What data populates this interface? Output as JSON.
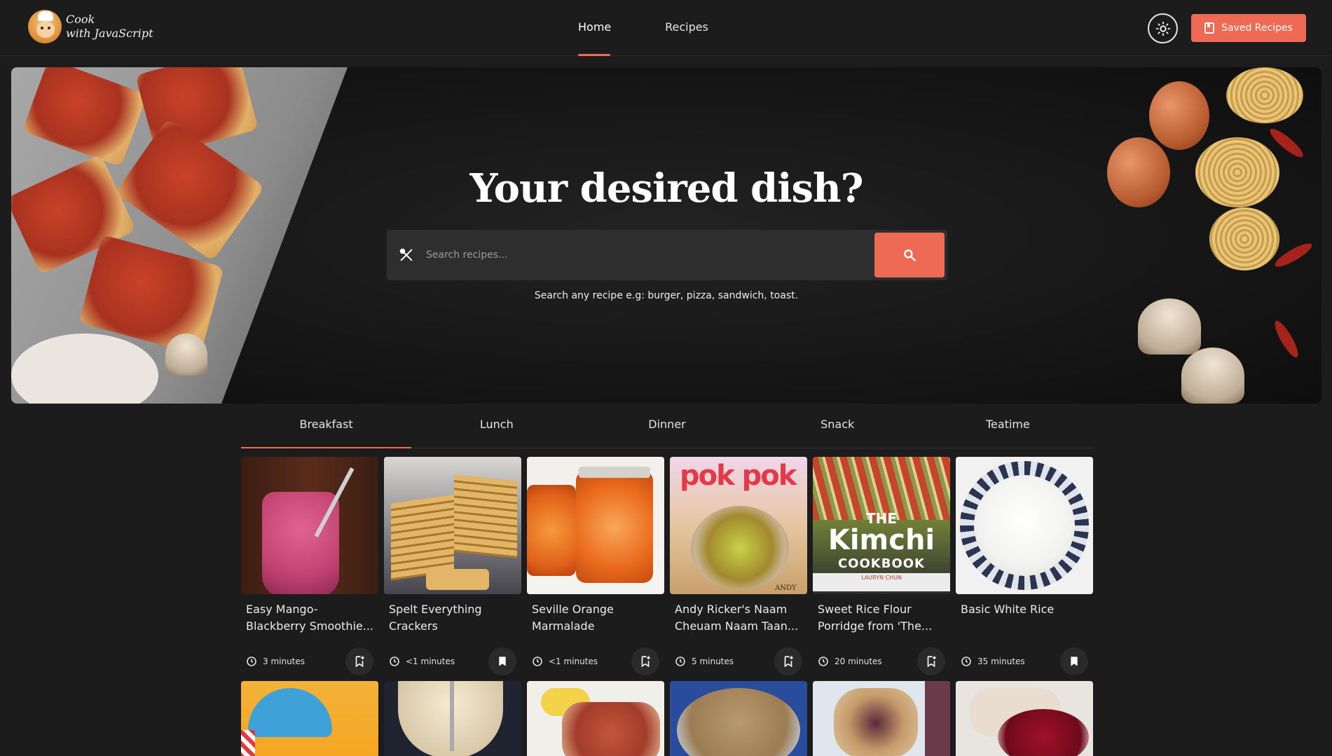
{
  "header": {
    "logo_line1": "Cook",
    "logo_line2": "with JavaScript",
    "nav": [
      {
        "label": "Home",
        "active": true
      },
      {
        "label": "Recipes",
        "active": false
      }
    ],
    "theme_icon": "sun-icon",
    "saved_label": "Saved Recipes",
    "accent_color": "#ef6a55"
  },
  "hero": {
    "title": "Your desired dish?",
    "search_placeholder": "Search recipes...",
    "search_value": "",
    "hint": "Search any recipe e.g: burger, pizza, sandwich, toast."
  },
  "tabs": [
    {
      "label": "Breakfast",
      "active": true
    },
    {
      "label": "Lunch",
      "active": false
    },
    {
      "label": "Dinner",
      "active": false
    },
    {
      "label": "Snack",
      "active": false
    },
    {
      "label": "Teatime",
      "active": false
    }
  ],
  "cards": [
    {
      "title": "Easy Mango-Blackberry Smoothie...",
      "time": "3 minutes",
      "saved": false
    },
    {
      "title": "Spelt Everything Crackers",
      "time": "<1 minutes",
      "saved": true
    },
    {
      "title": "Seville Orange Marmalade",
      "time": "<1 minutes",
      "saved": false
    },
    {
      "title": "Andy Ricker's Naam Cheuam Naam Taan...",
      "time": "5 minutes",
      "saved": false
    },
    {
      "title": "Sweet Rice Flour Porridge from 'The...",
      "time": "20 minutes",
      "saved": false
    },
    {
      "title": "Basic White Rice",
      "time": "35 minutes",
      "saved": true
    }
  ],
  "cover_text": {
    "pokpok": "pok pok",
    "andy": "ANDY",
    "kimchi_the": "THE",
    "kimchi_title": "Kimchi",
    "kimchi_sub": "COOKBOOK",
    "kimchi_author": "LAURYN CHUN"
  }
}
